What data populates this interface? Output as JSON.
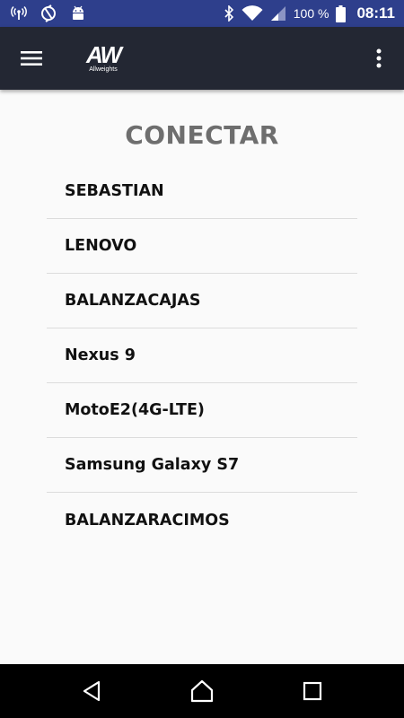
{
  "status_bar": {
    "icons_left": [
      "hotspot-icon",
      "sync-disabled-icon",
      "android-icon"
    ],
    "icons_right": [
      "bluetooth-icon",
      "wifi-icon",
      "signal-icon",
      "battery-icon"
    ],
    "battery_percent": "100 %",
    "time": "08:11",
    "color": "#2e3f8c"
  },
  "app_bar": {
    "logo_text": "AW",
    "logo_subtitle": "Allweights",
    "color": "#232733"
  },
  "main": {
    "title": "CONECTAR",
    "devices": [
      "SEBASTIAN",
      "LENOVO",
      "BALANZACAJAS",
      "Nexus 9",
      "MotoE2(4G-LTE)",
      "Samsung Galaxy S7",
      "BALANZARACIMOS"
    ]
  },
  "nav_bar": {
    "buttons": [
      "back-icon",
      "home-icon",
      "recents-icon"
    ]
  }
}
